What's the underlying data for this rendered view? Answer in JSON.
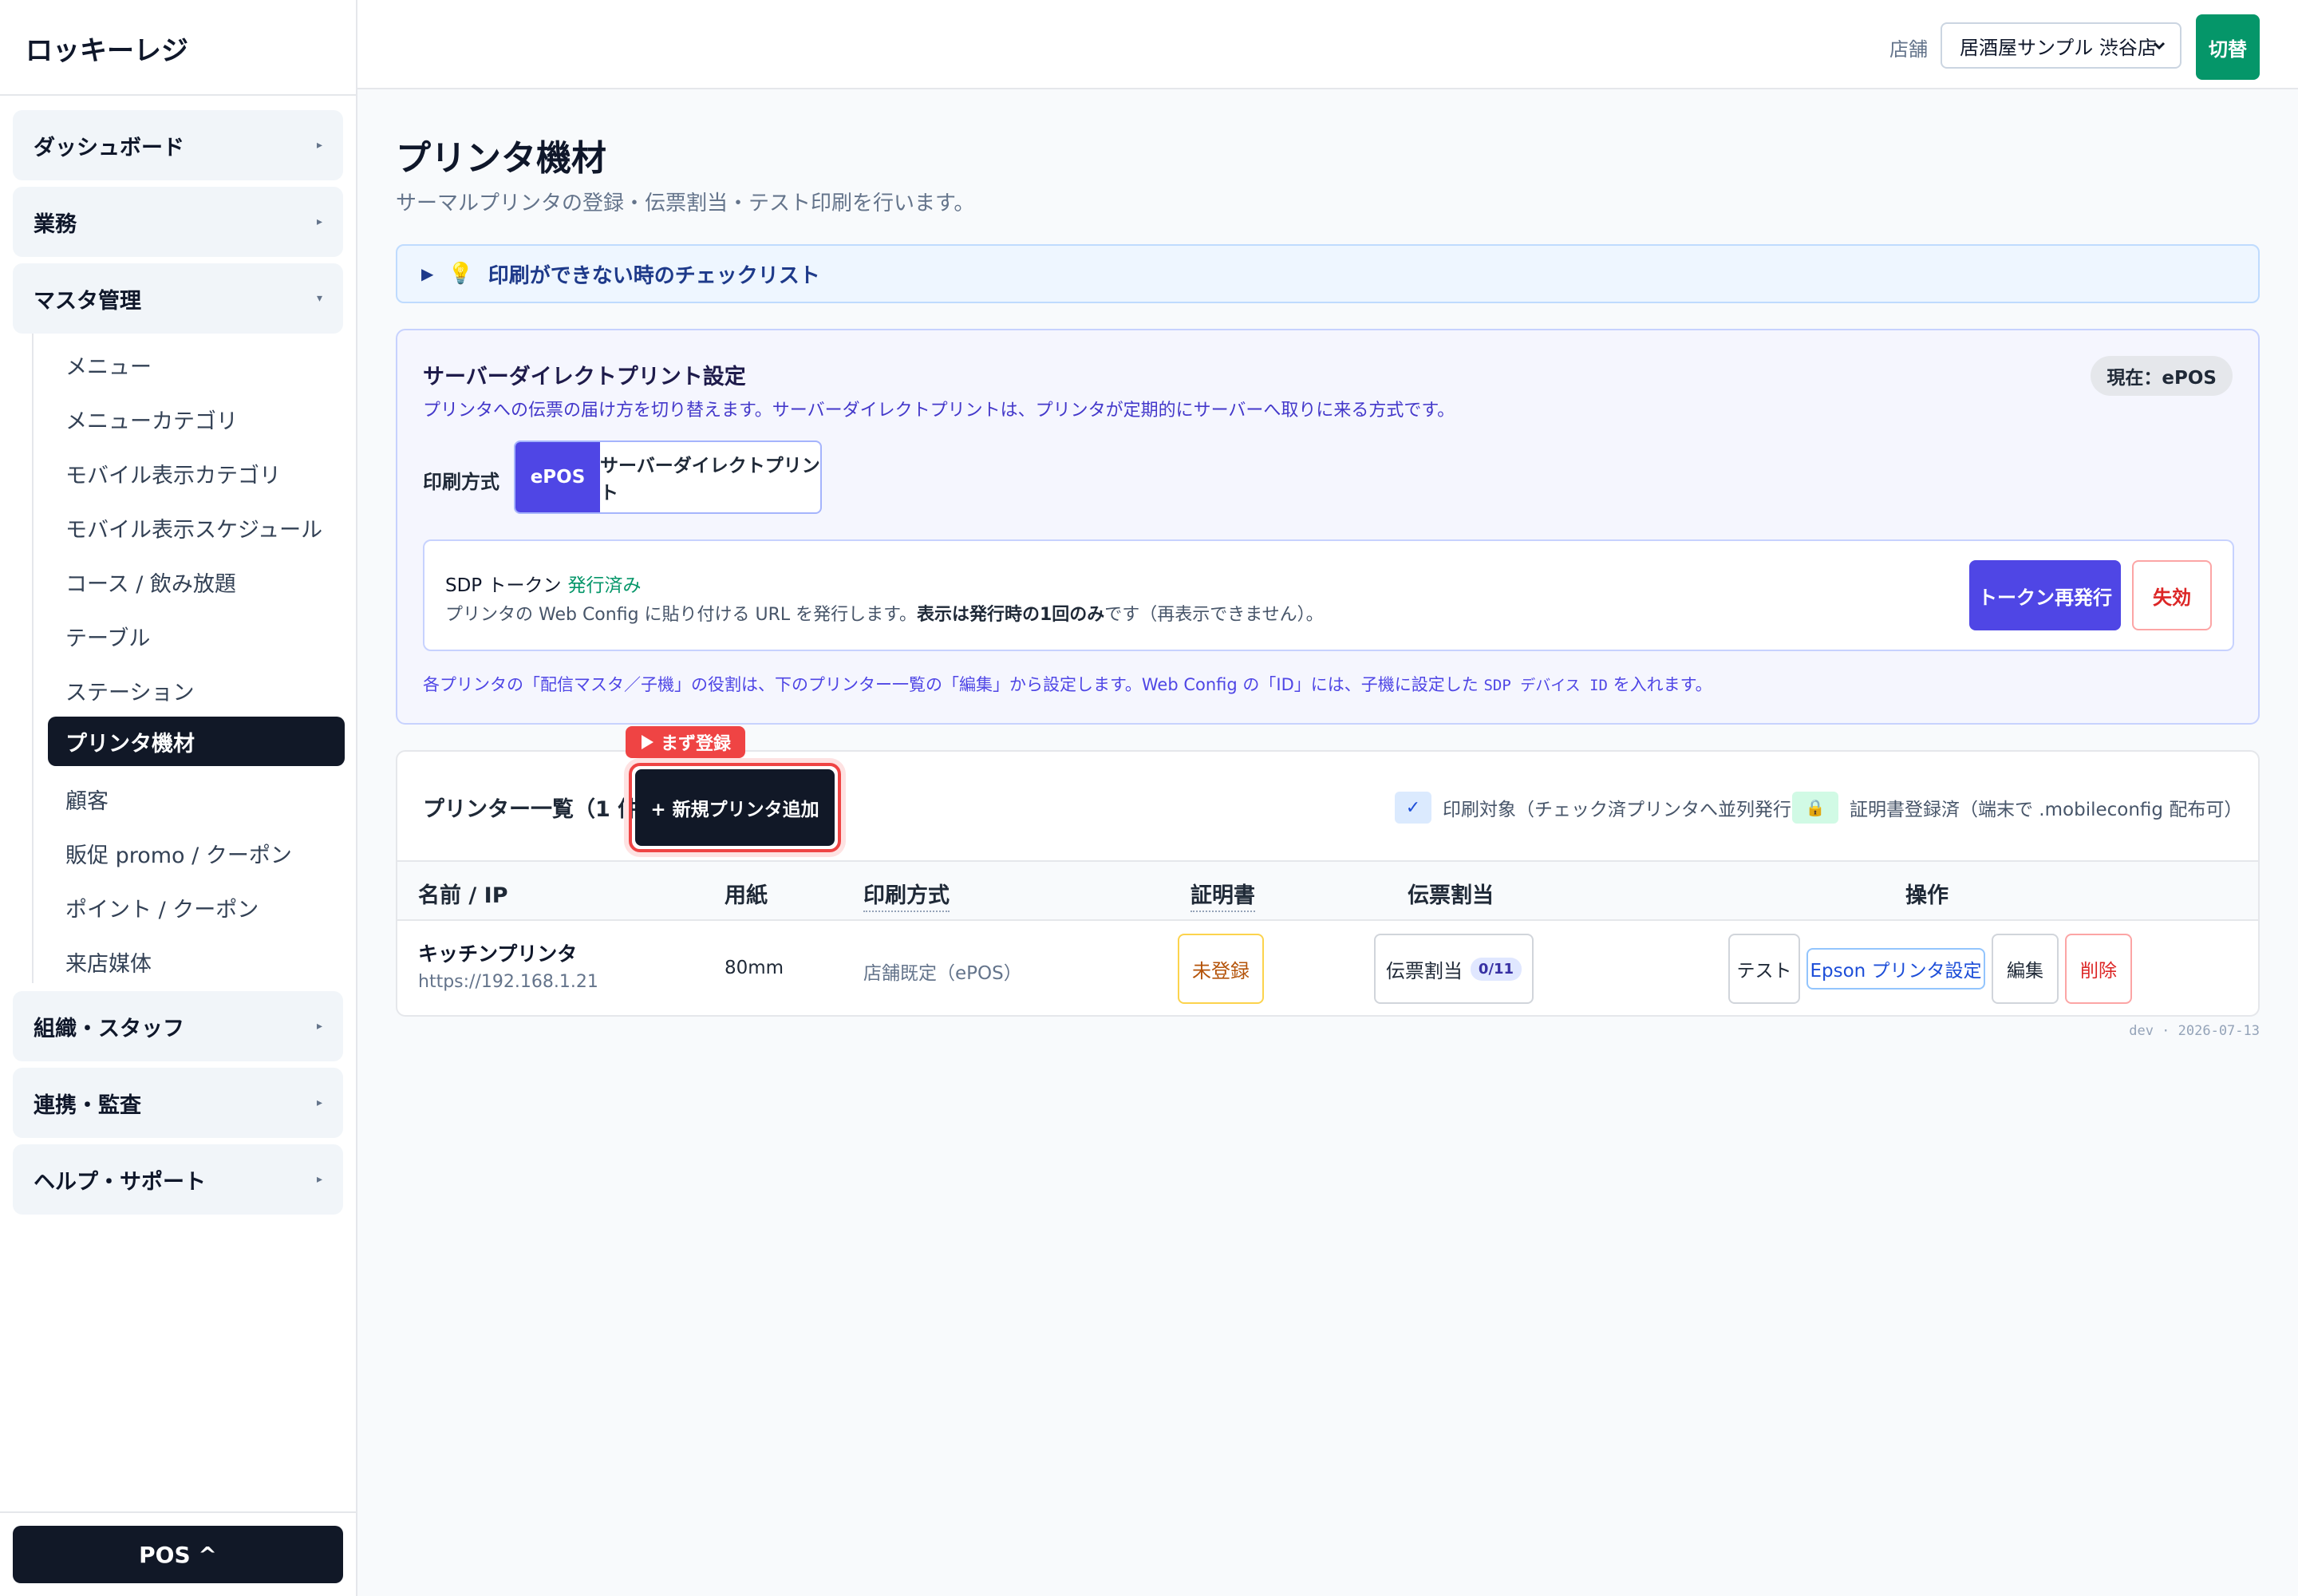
{
  "sidebar": {
    "brand": "ロッキーレジ",
    "groups": [
      {
        "label": "ダッシュボード",
        "arrow": "▸"
      },
      {
        "label": "業務",
        "arrow": "▸"
      },
      {
        "label": "マスタ管理",
        "arrow": "▾"
      },
      {
        "label": "組織・スタッフ",
        "arrow": "▸"
      },
      {
        "label": "連携・監査",
        "arrow": "▸"
      },
      {
        "label": "ヘルプ・サポート",
        "arrow": "▸"
      }
    ],
    "sub_items": [
      "メニュー",
      "メニューカテゴリ",
      "モバイル表示カテゴリ",
      "モバイル表示スケジュール",
      "コース / 飲み放題",
      "テーブル",
      "ステーション",
      "プリンタ機材",
      "顧客",
      "販促 promo / クーポン",
      "ポイント / クーポン",
      "来店媒体"
    ],
    "active_sub": "プリンタ機材",
    "pos_button": "POS ^"
  },
  "topbar": {
    "store_label": "店舗",
    "store_value": "居酒屋サンプル 渋谷店",
    "switch_button": "切替"
  },
  "page": {
    "title": "プリンタ機材",
    "subtitle": "サーマルプリンタの登録・伝票割当・テスト印刷を行います。",
    "checklist": {
      "arrow": "▶",
      "icon": "💡",
      "label": "印刷ができない時のチェックリスト"
    }
  },
  "sdp": {
    "title": "サーバーダイレクトプリント設定",
    "description": "プリンタへの伝票の届け方を切り替えます。サーバーダイレクトプリントは、プリンタが定期的にサーバーへ取りに来る方式です。",
    "current_badge": "現在：ePOS",
    "mode_label": "印刷方式",
    "mode_options": [
      "ePOS",
      "サーバーダイレクトプリント"
    ],
    "selected_mode": "ePOS",
    "token": {
      "title": "SDP トークン",
      "status": "発行済み",
      "desc_prefix": "プリンタの Web Config に貼り付ける URL を発行します。",
      "desc_bold": "表示は発行時の1回のみ",
      "desc_suffix": "です（再表示できません）。",
      "reissue_button": "トークン再発行",
      "revoke_button": "失効"
    },
    "note_prefix": "各プリンタの「配信マスタ／子機」の役割は、下のプリンター一覧の「編集」から設定します。Web Config の「ID」には、子機に設定した",
    "note_code": "SDP デバイス ID",
    "note_suffix": "を入れます。"
  },
  "printers": {
    "count_label": "プリンター一覧（1 件）",
    "first_tag": "まず登録",
    "add_button": "+ 新規プリンタ追加",
    "legend_check": "印刷対象（チェック済プリンタへ並列発行）",
    "legend_cert": "証明書登録済（端末で .mobileconfig 配布可）",
    "columns": [
      "名前 / IP",
      "用紙",
      "印刷方式",
      "証明書",
      "伝票割当",
      "操作"
    ],
    "rows": [
      {
        "name": "キッチンプリンタ",
        "ip": "https://192.168.1.21",
        "paper": "80mm",
        "method": "店舗既定（ePOS）",
        "cert": "未登録",
        "slip_label": "伝票割当",
        "slip_count": "0/11",
        "actions": {
          "test": "テスト",
          "epson": "Epson プリンタ設定",
          "edit": "編集",
          "delete": "削除"
        }
      }
    ]
  },
  "footer": {
    "version": "dev · 2026-07-13"
  }
}
